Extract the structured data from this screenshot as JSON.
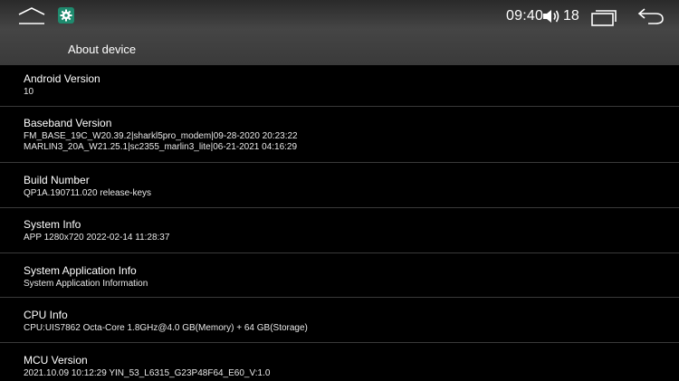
{
  "status_bar": {
    "home_icon": "home-icon",
    "app_icon": "settings-gear-icon",
    "app_icon_color": "#1f8a6e",
    "time": "09:40",
    "volume_icon": "volume-icon",
    "volume_level": "18",
    "recents_icon": "recents-icon",
    "back_icon": "back-arrow-icon"
  },
  "header": {
    "title": "About device"
  },
  "items": [
    {
      "title": "Android Version",
      "lines": [
        "10"
      ]
    },
    {
      "title": "Baseband Version",
      "lines": [
        "FM_BASE_19C_W20.39.2|sharkl5pro_modem|09-28-2020 20:23:22",
        "MARLIN3_20A_W21.25.1|sc2355_marlin3_lite|06-21-2021 04:16:29"
      ]
    },
    {
      "title": "Build Number",
      "lines": [
        "QP1A.190711.020 release-keys"
      ]
    },
    {
      "title": "System Info",
      "lines": [
        "APP 1280x720 2022-02-14 11:28:37"
      ]
    },
    {
      "title": "System Application Info",
      "lines": [
        "System Application Information"
      ]
    },
    {
      "title": "CPU Info",
      "lines": [
        "CPU:UIS7862 Octa-Core 1.8GHz@4.0 GB(Memory) + 64 GB(Storage)"
      ]
    },
    {
      "title": "MCU Version",
      "lines": [
        "2021.10.09 10:12:29 YIN_53_L6315_G23P48F64_E60_V:1.0"
      ]
    }
  ],
  "colors": {
    "background": "#000000",
    "divider": "#3a3a3a",
    "text": "#ffffff"
  }
}
